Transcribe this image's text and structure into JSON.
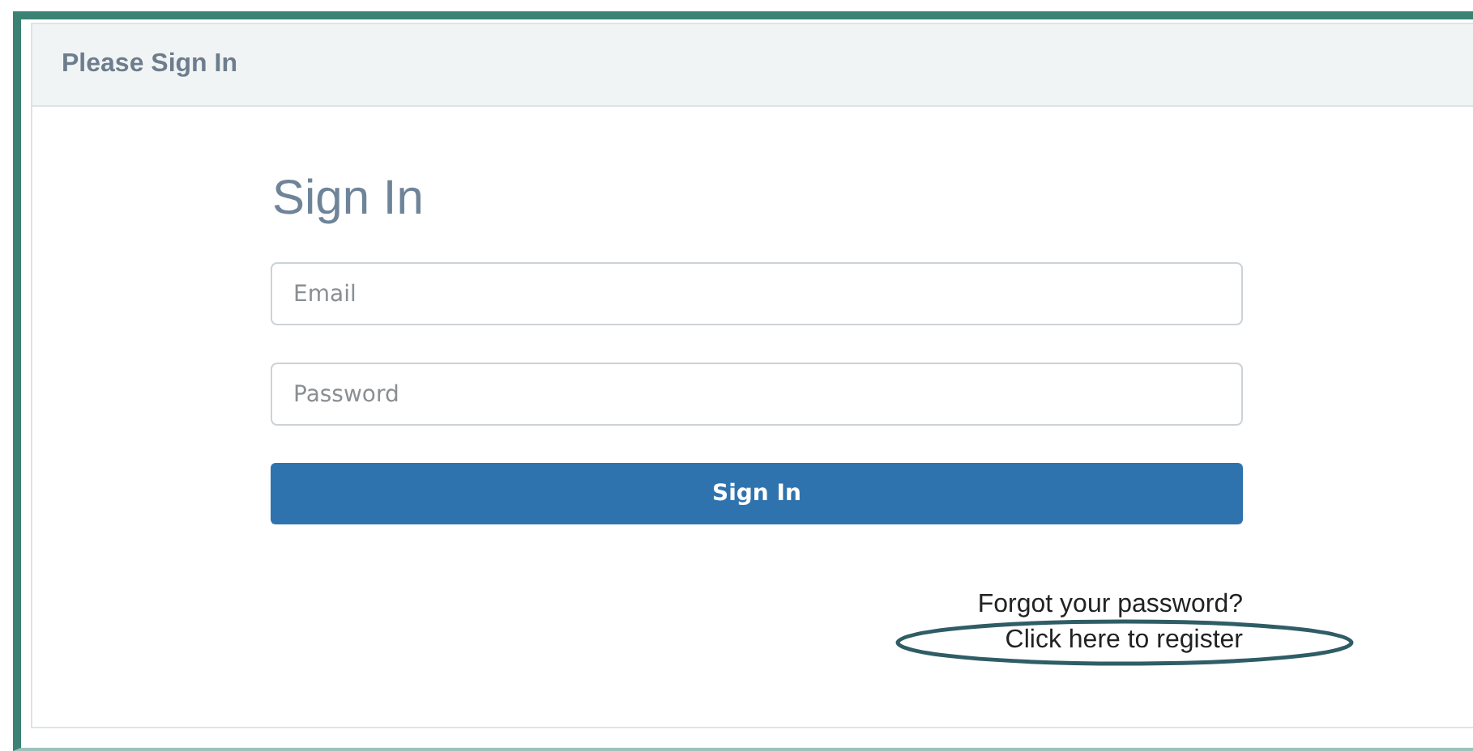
{
  "panel": {
    "title": "Please Sign In"
  },
  "form": {
    "heading": "Sign In",
    "fields": [
      {
        "placeholder": "Email"
      },
      {
        "placeholder": "Password"
      }
    ],
    "submit": "Sign In"
  },
  "links": [
    {
      "label": "Forgot your password?",
      "highlighted": false
    },
    {
      "label": "Click here to register",
      "highlighted": true
    }
  ]
}
